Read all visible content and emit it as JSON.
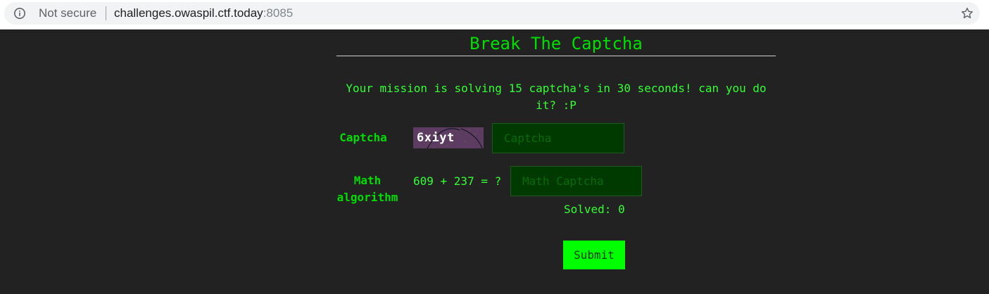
{
  "browser": {
    "security_label": "Not secure",
    "url_host": "challenges.owaspil.ctf.today",
    "url_port": ":8085"
  },
  "page": {
    "title": "Break The Captcha",
    "mission": "Your mission is solving 15 captcha's in 30 seconds! can you do it? :P"
  },
  "form": {
    "captcha_label": "Captcha",
    "captcha_image_text": "6xiyt",
    "captcha_placeholder": "Captcha",
    "math_label": "Math algorithm",
    "math_question": "609 + 237 = ?",
    "math_placeholder": "Math Captcha",
    "solved_text": "Solved: 0",
    "submit_label": "Submit"
  },
  "colors": {
    "background": "#222222",
    "accent_green": "#00ff00",
    "text_green": "#33ff33",
    "input_bg": "#003a00"
  },
  "icons": {
    "security": "info-circle-icon",
    "bookmark": "star-outline-icon"
  }
}
